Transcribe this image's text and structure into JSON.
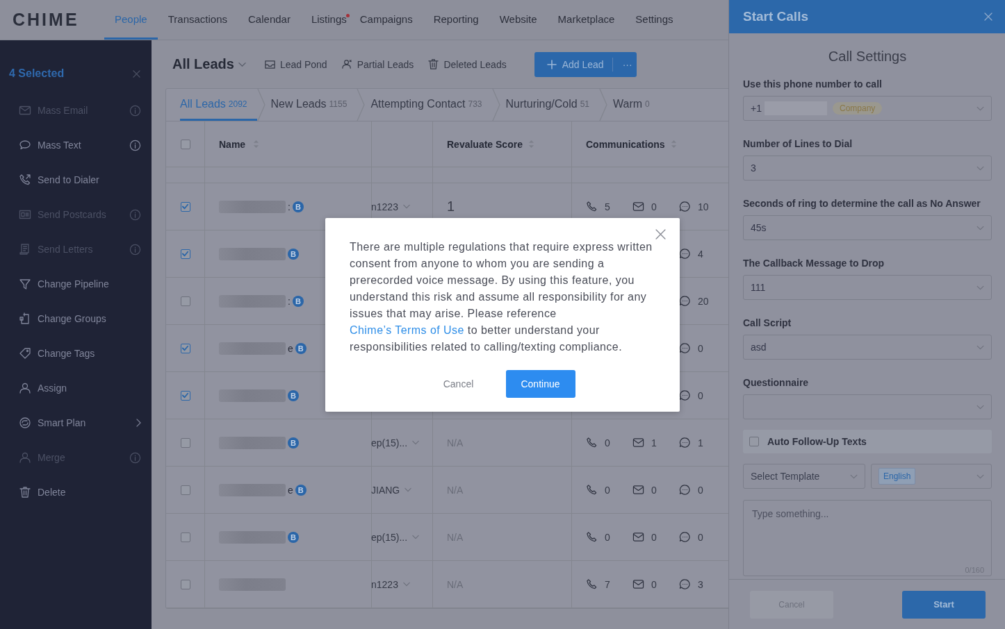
{
  "logo": "CHIME",
  "nav": [
    {
      "label": "People",
      "selected": true,
      "dot": false
    },
    {
      "label": "Transactions",
      "selected": false,
      "dot": false
    },
    {
      "label": "Calendar",
      "selected": false,
      "dot": false
    },
    {
      "label": "Listings",
      "selected": false,
      "dot": true
    },
    {
      "label": "Campaigns",
      "selected": false,
      "dot": false
    },
    {
      "label": "Reporting",
      "selected": false,
      "dot": false
    },
    {
      "label": "Website",
      "selected": false,
      "dot": false
    },
    {
      "label": "Marketplace",
      "selected": false,
      "dot": false
    },
    {
      "label": "Settings",
      "selected": false,
      "dot": false
    }
  ],
  "sidebar": {
    "title": "4 Selected",
    "items": [
      {
        "label": "Mass Email",
        "disabled": true,
        "info": true,
        "submenu": false
      },
      {
        "label": "Mass Text",
        "disabled": false,
        "info": true,
        "submenu": false
      },
      {
        "label": "Send to Dialer",
        "disabled": false,
        "info": false,
        "submenu": false
      },
      {
        "label": "Send Postcards",
        "disabled": true,
        "info": true,
        "submenu": false
      },
      {
        "label": "Send Letters",
        "disabled": true,
        "info": true,
        "submenu": false
      },
      {
        "label": "Change Pipeline",
        "disabled": false,
        "info": false,
        "submenu": false
      },
      {
        "label": "Change Groups",
        "disabled": false,
        "info": false,
        "submenu": false
      },
      {
        "label": "Change Tags",
        "disabled": false,
        "info": false,
        "submenu": false
      },
      {
        "label": "Assign",
        "disabled": false,
        "info": false,
        "submenu": false
      },
      {
        "label": "Smart Plan",
        "disabled": false,
        "info": false,
        "submenu": true
      },
      {
        "label": "Merge",
        "disabled": true,
        "info": true,
        "submenu": false
      },
      {
        "label": "Delete",
        "disabled": false,
        "info": false,
        "submenu": false
      }
    ]
  },
  "toolbar": {
    "title": "All Leads",
    "links": [
      "Lead Pond",
      "Partial Leads",
      "Deleted Leads"
    ],
    "add_button": "Add Lead",
    "more": "···"
  },
  "tabs": [
    {
      "label": "All Leads",
      "count": "2092",
      "selected": true
    },
    {
      "label": "New Leads",
      "count": "1155",
      "selected": false
    },
    {
      "label": "Attempting Contact",
      "count": "733",
      "selected": false
    },
    {
      "label": "Nurturing/Cold",
      "count": "51",
      "selected": false
    },
    {
      "label": "Warm",
      "count": "0",
      "selected": false
    }
  ],
  "table": {
    "columns": [
      "Name",
      "",
      "Revaluate Score",
      "Communications"
    ],
    "header_checked": false,
    "rows": [
      {
        "checked": true,
        "fragment": ":",
        "badge": "B",
        "column_3": "n1223",
        "score": "1",
        "calls": "5",
        "emails": "0",
        "texts": "10"
      },
      {
        "checked": true,
        "badge": "B",
        "texts": "4"
      },
      {
        "checked": false,
        "fragment": ":",
        "badge": "B",
        "texts": "20"
      },
      {
        "checked": true,
        "fragment": "e",
        "badge": "B",
        "texts": "0"
      },
      {
        "checked": true,
        "badge": "B",
        "texts": "0"
      },
      {
        "checked": false,
        "badge": "B",
        "column_3": "ep(15)...",
        "score": "N/A",
        "calls": "0",
        "emails": "1",
        "texts": "1"
      },
      {
        "checked": false,
        "fragment": "e",
        "badge": "B",
        "column_3": "JIANG",
        "score": "N/A",
        "calls": "0",
        "emails": "0",
        "texts": "0"
      },
      {
        "checked": false,
        "badge": "B",
        "column_3": "ep(15)...",
        "score": "N/A",
        "calls": "0",
        "emails": "0",
        "texts": "0"
      },
      {
        "checked": false,
        "column_3": "n1223",
        "score": "N/A",
        "calls": "7",
        "emails": "0",
        "texts": "3"
      }
    ]
  },
  "modal": {
    "text_before": "There are multiple regulations that require express written consent from anyone to whom you are sending a prerecorded voice message. By using this feature, you understand this risk and assume all responsibility for any issues that may arise. Please reference ",
    "link": "Chime’s Terms of Use",
    "text_after": " to better understand your responsibilities related to calling/texting compliance.",
    "cancel": "Cancel",
    "confirm": "Continue"
  },
  "panel": {
    "title": "Start Calls",
    "heading": "Call Settings",
    "phone": {
      "label": "Use this phone number to call",
      "prefix": "+1",
      "tag": "Company"
    },
    "fields": [
      {
        "label": "Number of Lines to Dial",
        "value": "3"
      },
      {
        "label": "Seconds of ring to determine the call as No Answer",
        "value": "45s"
      },
      {
        "label": "The Callback Message to Drop",
        "value": "111"
      },
      {
        "label": "Call Script",
        "value": "asd"
      },
      {
        "label": "Questionnaire"
      }
    ],
    "follow_up": {
      "label": "Auto Follow-Up Texts",
      "checked": false
    },
    "template": {
      "placeholder": "Select Template",
      "language": "English"
    },
    "message": {
      "placeholder": "Type something...",
      "counter": "0/160"
    },
    "cancel": "Cancel",
    "start": "Start"
  }
}
